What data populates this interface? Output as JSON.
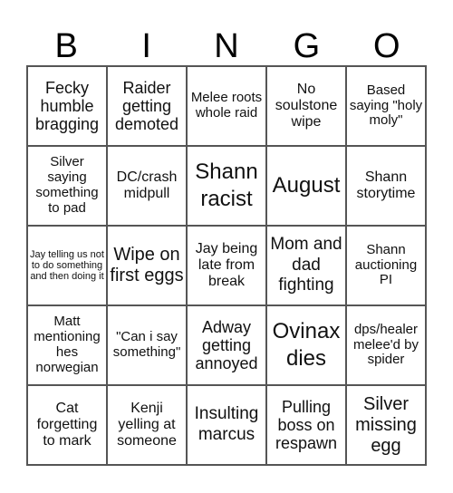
{
  "header": [
    "B",
    "I",
    "N",
    "G",
    "O"
  ],
  "cells": [
    [
      "Fecky humble bragging",
      "Raider getting demoted",
      "Melee roots whole raid",
      "No soulstone wipe",
      "Based saying \"holy moly\""
    ],
    [
      "Silver saying something to pad",
      "DC/crash midpull",
      "Shann racist",
      "August",
      "Shann storytime"
    ],
    [
      "Jay telling us not to do something and then doing it",
      "Wipe on first eggs",
      "Jay being late from break",
      "Mom and dad fighting",
      "Shann auctioning PI"
    ],
    [
      "Matt mentioning hes norwegian",
      "\"Can i say something\"",
      "Adway getting annoyed",
      "Ovinax dies",
      "dps/healer melee'd by spider"
    ],
    [
      "Cat forgetting to mark",
      "Kenji yelling at someone",
      "Insulting marcus",
      "Pulling boss on respawn",
      "Silver missing egg"
    ]
  ]
}
